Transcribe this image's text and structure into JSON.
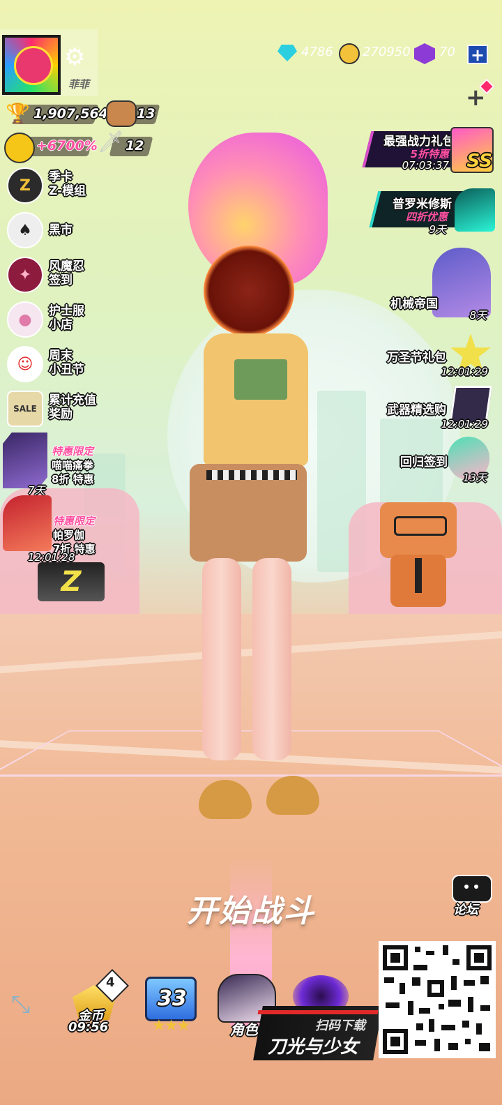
{
  "resources": {
    "diamonds": "4786",
    "coins": "270950",
    "tickets": "70"
  },
  "profile": {
    "nickname": "菲菲",
    "power": "1,907,564",
    "pet_count": "13",
    "bonus": "+6700%",
    "sword_count": "12"
  },
  "left_menu": [
    {
      "label": "季卡\nZ-模组",
      "icon": "z-card-icon"
    },
    {
      "label": "黑市",
      "icon": "spade-icon"
    },
    {
      "label": "风魔忍\n签到",
      "icon": "ninja-star-icon"
    },
    {
      "label": "护士服\n小店",
      "icon": "nurse-outfit-icon"
    },
    {
      "label": "周末\n小丑节",
      "icon": "clown-icon"
    },
    {
      "label": "累计充值\n奖励",
      "icon": "sale-tag-icon"
    }
  ],
  "left_offers": [
    {
      "tag": "特惠限定",
      "name": "喵喵痛拳",
      "discount": "8折 特惠",
      "time": "7天"
    },
    {
      "tag": "特惠限定",
      "name": "帕罗伽",
      "discount": "7折 特惠",
      "time": "12:01:28"
    }
  ],
  "right_offers": [
    {
      "title": "最强战力礼包",
      "sub": "5折特惠",
      "time": "07:03:37",
      "badge": "SS"
    },
    {
      "title": "普罗米修斯",
      "sub": "四折优惠",
      "time": "9天"
    },
    {
      "title": "机械帝国",
      "time": "8天"
    },
    {
      "title": "万圣节礼包",
      "time": "12:01:29"
    },
    {
      "title": "武器精选购",
      "time": "12:01:29"
    },
    {
      "title": "回归签到",
      "time": "13天"
    }
  ],
  "start_button": "开始战斗",
  "forum": "论坛",
  "bottom": {
    "gold_badge": "4",
    "gold_label": "金币",
    "gold_time": "09:56",
    "level": "33",
    "role_label": "角色"
  },
  "promo": {
    "scan": "扫码下载",
    "game": "刀光与少女"
  },
  "colors": {
    "accent_blue": "#1e4bb0",
    "brand_pink": "#e9386e",
    "gold": "#f2c23b"
  }
}
